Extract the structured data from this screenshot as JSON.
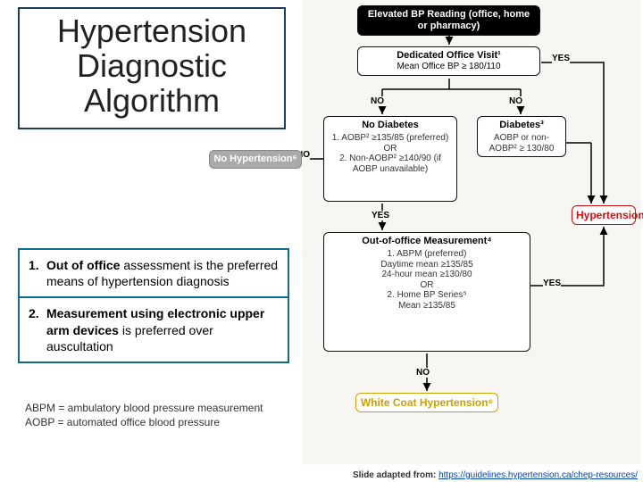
{
  "title": {
    "line1": "Hypertension",
    "line2": "Diagnostic",
    "line3": "Algorithm"
  },
  "notes": {
    "item1": {
      "num": "1.",
      "bold": "Out of office",
      "rest": " assessment is the preferred means of hypertension diagnosis"
    },
    "item2": {
      "num": "2.",
      "bold": "Measurement using electronic upper arm devices",
      "rest": " is preferred over auscultation"
    }
  },
  "defs": {
    "abpm": "ABPM = ambulatory blood pressure measurement",
    "aobp": "AOBP = automated office blood pressure"
  },
  "attrib": {
    "prefix": "Slide adapted from: ",
    "link": "https://guidelines.hypertension.ca/chep-resources/"
  },
  "diagram": {
    "elevated": "Elevated BP Reading (office, home or pharmacy)",
    "dedicated_hdr": "Dedicated Office Visit¹",
    "dedicated_sub": "Mean Office BP ≥ 180/110",
    "no_diabetes_hdr": "No Diabetes",
    "no_diabetes_sub": "1. AOBP² ≥135/85 (preferred)\nOR\n2. Non-AOBP² ≥140/90 (if AOBP unavailable)",
    "diabetes_hdr": "Diabetes³",
    "diabetes_sub": "AOBP or non-AOBP² ≥ 130/80",
    "ooo_hdr": "Out-of-office Measurement⁴",
    "ooo_sub": "1. ABPM (preferred)\nDaytime mean ≥135/85\n24-hour mean ≥130/80\nOR\n2. Home BP Series⁵\nMean ≥135/85",
    "hypertension": "Hypertension",
    "no_hyp": "No Hypertension⁶",
    "wch": "White Coat Hypertension⁶",
    "labels": {
      "yes": "YES",
      "no": "NO"
    }
  }
}
